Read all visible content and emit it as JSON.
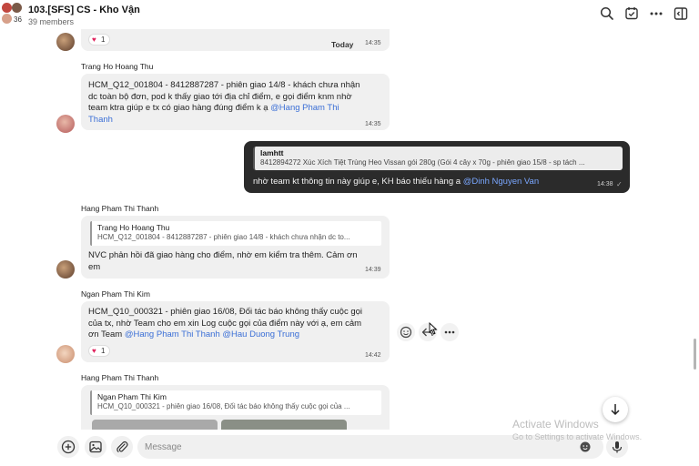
{
  "header": {
    "title": "103.[SFS] CS - Kho Vận",
    "members": "39 members",
    "avatar_count": "36"
  },
  "messages": {
    "m0": {
      "reaction_count": "1",
      "divider": "Today",
      "time": "14:35"
    },
    "m1": {
      "sender": "Trang Ho Hoang Thu",
      "line1": "HCM_Q12_001804 - 8412887287 - phiên giao 14/8 - khách chưa nhận",
      "line2": "dc toàn bộ đơn, pod k thấy giao tới địa chỉ điểm, e gọi điểm knm nhờ",
      "line3": "team ktra giúp e tx có giao hàng đúng điểm k ạ ",
      "mention1": "@Hang Pham Thi",
      "line4": "Thanh",
      "time": "14:35"
    },
    "m2": {
      "quote_name": "lamhtt",
      "quote_text": "8412894272 Xúc Xích Tiệt Trùng Heo Vissan gói 280g (Gói 4 cây x 70g - phiên giao 15/8 - sp tách ...",
      "text": "nhờ team kt thông tin này giúp e, KH báo thiếu hàng a ",
      "mention": "@Dinh Nguyen Van",
      "time": "14:38"
    },
    "m3": {
      "sender": "Hang Pham Thi Thanh",
      "quote_name": "Trang Ho Hoang Thu",
      "quote_text": "HCM_Q12_001804 - 8412887287 - phiên giao 14/8 - khách chưa nhận dc to...",
      "line1": "NVC phản hồi đã giao hàng cho điểm, nhờ em kiểm tra thêm. Cảm ơn",
      "line2": "em",
      "time": "14:39"
    },
    "m4": {
      "sender": "Ngan Pham Thi Kim",
      "line1": "HCM_Q10_000321  - phiên giao 16/08, Đối tác báo không thấy cuộc gọi",
      "line2": "của tx, nhờ Team cho em xin Log cuộc gọi của điểm này với ạ, em cảm",
      "line3": "ơn Team ",
      "mention1": "@Hang Pham Thi Thanh",
      "mention2": "@Hau Duong Trung",
      "reaction_count": "1",
      "time": "14:42"
    },
    "m5": {
      "sender": "Hang Pham Thi Thanh",
      "quote_name": "Ngan Pham Thi Kim",
      "quote_text": "HCM_Q10_000321 - phiên giao 16/08, Đối tác báo không thấy cuộc gọi của ..."
    }
  },
  "composer": {
    "placeholder": "Message"
  },
  "watermark": {
    "line1": "Activate Windows",
    "line2": "Go to Settings to activate Windows."
  },
  "icons": {
    "search": "search-icon",
    "tasks": "task-check-icon",
    "more": "more-icon",
    "panel": "side-panel-icon"
  },
  "colors": {
    "mention": "#3b6fd6",
    "dark_bubble": "#2b2b2b",
    "bubble": "#f0f0f0"
  }
}
